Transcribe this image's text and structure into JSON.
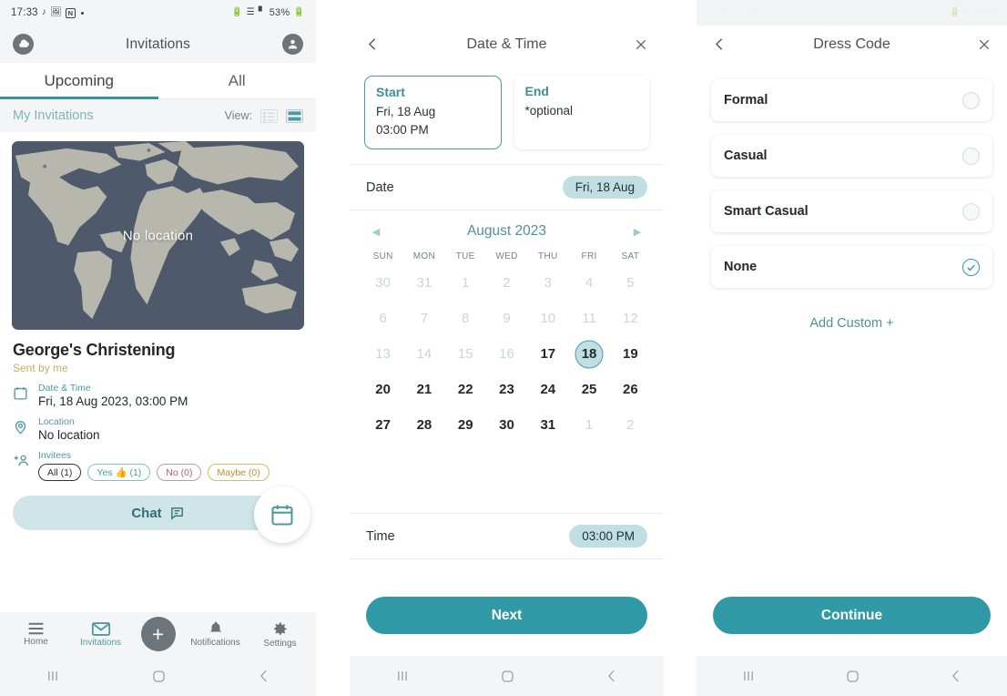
{
  "statusbar": {
    "time": "17:33",
    "icons": [
      "music-note-icon",
      "image-icon",
      "notion-icon",
      "dot-icon"
    ],
    "right_icons": [
      "battery-saver-icon",
      "bluetooth-icon",
      "signal-icon"
    ],
    "battery": "53%"
  },
  "panel1": {
    "appbar": {
      "title": "Invitations",
      "left_icon": "cloud-icon",
      "right_icon": "account-icon"
    },
    "tabs": [
      {
        "label": "Upcoming",
        "active": true
      },
      {
        "label": "All",
        "active": false
      }
    ],
    "strip": {
      "title": "My Invitations",
      "view_label": "View:",
      "views": [
        "list-view-icon",
        "card-view-icon"
      ]
    },
    "map": {
      "label": "No location"
    },
    "event": {
      "title": "George's Christening",
      "sent_by": "Sent by me",
      "datetime_label": "Date & Time",
      "datetime_value": "Fri, 18 Aug 2023, 03:00 PM",
      "location_label": "Location",
      "location_value": "No location",
      "invitees_label": "Invitees",
      "chips": [
        {
          "label": "All (1)",
          "kind": "all"
        },
        {
          "label": "Yes 👍 (1)",
          "kind": "yes"
        },
        {
          "label": "No (0)",
          "kind": "no"
        },
        {
          "label": "Maybe (0)",
          "kind": "maybe"
        }
      ]
    },
    "chat_button": "Chat",
    "fab_icon": "calendar-icon",
    "bottomnav": [
      {
        "label": "Home",
        "icon": "menu-icon",
        "active": false
      },
      {
        "label": "Invitations",
        "icon": "envelope-icon",
        "active": true
      },
      {
        "label": "",
        "icon": "plus-icon",
        "active": false
      },
      {
        "label": "Notifications",
        "icon": "bell-icon",
        "active": false
      },
      {
        "label": "Settings",
        "icon": "gear-icon",
        "active": false
      }
    ]
  },
  "panel2": {
    "appbar": {
      "title": "Date & Time",
      "back_icon": "chevron-left-icon",
      "close_icon": "close-icon"
    },
    "start_card": {
      "label": "Start",
      "line1": "Fri, 18 Aug",
      "line2": "03:00 PM",
      "selected": true
    },
    "end_card": {
      "label": "End",
      "line1": "*optional",
      "line2": "",
      "selected": false
    },
    "date_row": {
      "label": "Date",
      "value": "Fri, 18 Aug"
    },
    "calendar": {
      "month": "August 2023",
      "prev_icon": "triangle-left-icon",
      "next_icon": "triangle-right-icon",
      "dow": [
        "SUN",
        "MON",
        "TUE",
        "WED",
        "THU",
        "FRI",
        "SAT"
      ],
      "weeks": [
        [
          {
            "d": "30",
            "mute": true
          },
          {
            "d": "31",
            "mute": true
          },
          {
            "d": "1",
            "mute": true
          },
          {
            "d": "2",
            "mute": true
          },
          {
            "d": "3",
            "mute": true
          },
          {
            "d": "4",
            "mute": true
          },
          {
            "d": "5",
            "mute": true
          }
        ],
        [
          {
            "d": "6",
            "mute": true
          },
          {
            "d": "7",
            "mute": true
          },
          {
            "d": "8",
            "mute": true
          },
          {
            "d": "9",
            "mute": true
          },
          {
            "d": "10",
            "mute": true
          },
          {
            "d": "11",
            "mute": true
          },
          {
            "d": "12",
            "mute": true
          }
        ],
        [
          {
            "d": "13",
            "mute": true
          },
          {
            "d": "14",
            "mute": true
          },
          {
            "d": "15",
            "mute": true
          },
          {
            "d": "16",
            "mute": true
          },
          {
            "d": "17",
            "mute": false
          },
          {
            "d": "18",
            "mute": false,
            "selected": true
          },
          {
            "d": "19",
            "mute": false
          }
        ],
        [
          {
            "d": "20",
            "mute": false
          },
          {
            "d": "21",
            "mute": false
          },
          {
            "d": "22",
            "mute": false
          },
          {
            "d": "23",
            "mute": false
          },
          {
            "d": "24",
            "mute": false
          },
          {
            "d": "25",
            "mute": false
          },
          {
            "d": "26",
            "mute": false
          }
        ],
        [
          {
            "d": "27",
            "mute": false
          },
          {
            "d": "28",
            "mute": false
          },
          {
            "d": "29",
            "mute": false
          },
          {
            "d": "30",
            "mute": false
          },
          {
            "d": "31",
            "mute": false
          },
          {
            "d": "1",
            "mute": true
          },
          {
            "d": "2",
            "mute": true
          }
        ]
      ]
    },
    "time_row": {
      "label": "Time",
      "value": "03:00 PM"
    },
    "primary_button": "Next"
  },
  "panel3": {
    "appbar": {
      "title": "Dress Code",
      "back_icon": "chevron-left-icon",
      "close_icon": "close-icon"
    },
    "options": [
      {
        "label": "Formal",
        "selected": false
      },
      {
        "label": "Casual",
        "selected": false
      },
      {
        "label": "Smart Casual",
        "selected": false
      },
      {
        "label": "None",
        "selected": true
      }
    ],
    "add_custom": "Add Custom +",
    "primary_button": "Continue"
  },
  "sysnav": [
    "recents-icon",
    "home-icon",
    "back-icon"
  ],
  "colors": {
    "accent": "#2f9aa5",
    "accent_light": "#bfdfe3",
    "chat_bg": "#cfe5e8",
    "map_ocean": "#4e5a6b",
    "map_land": "#b9b8ae",
    "sent_by": "#d0ab5e",
    "statusbar_bg": "#f4f5f6"
  }
}
